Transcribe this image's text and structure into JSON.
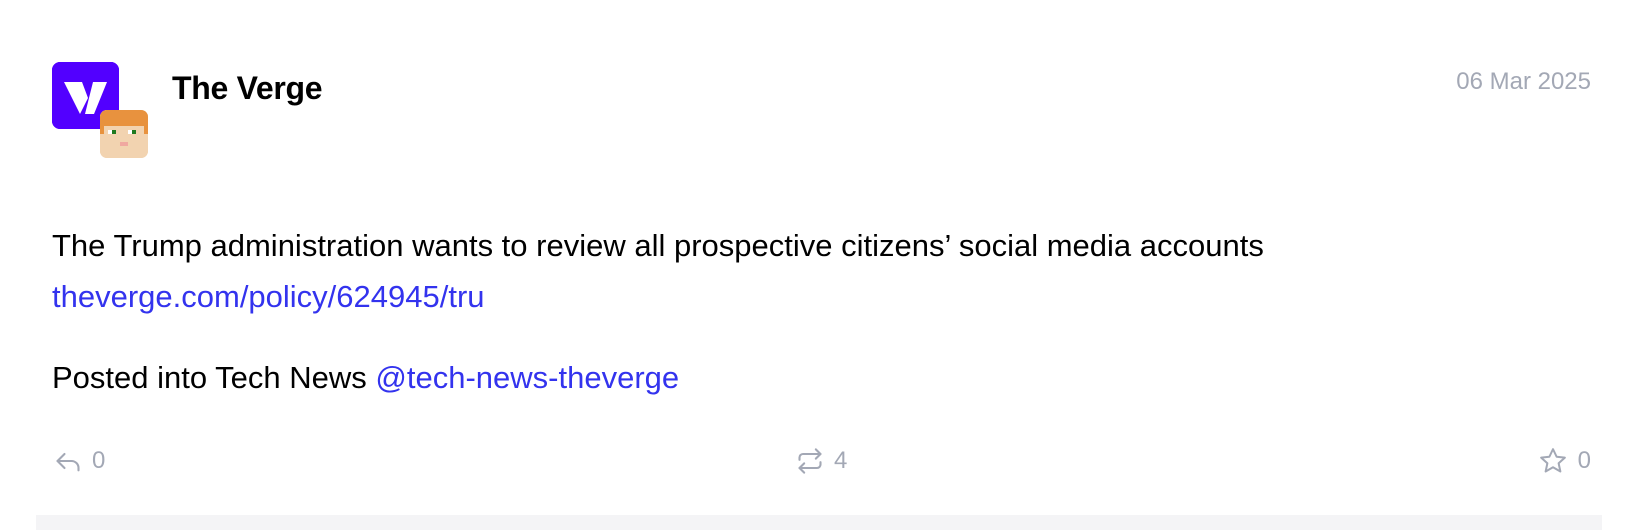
{
  "post": {
    "author": "The Verge",
    "date": "06 Mar 2025",
    "text": "The Trump administration wants to review all prospective citizens’ social media accounts",
    "link": "theverge.com/policy/624945/tru",
    "posted_into_prefix": "Posted into Tech News",
    "mention": "@tech-news-theverge",
    "avatar_icon": "verge-logo-icon",
    "sub_avatar_icon": "pixel-face-avatar-icon"
  },
  "actions": {
    "reply_icon": "reply-icon",
    "reply_count": "0",
    "boost_icon": "repost-icon",
    "boost_count": "4",
    "star_icon": "star-icon",
    "star_count": "0"
  },
  "colors": {
    "verge_purple": "#5200ff",
    "link_blue": "#3333ee",
    "muted_gray": "#a3a8b5"
  }
}
